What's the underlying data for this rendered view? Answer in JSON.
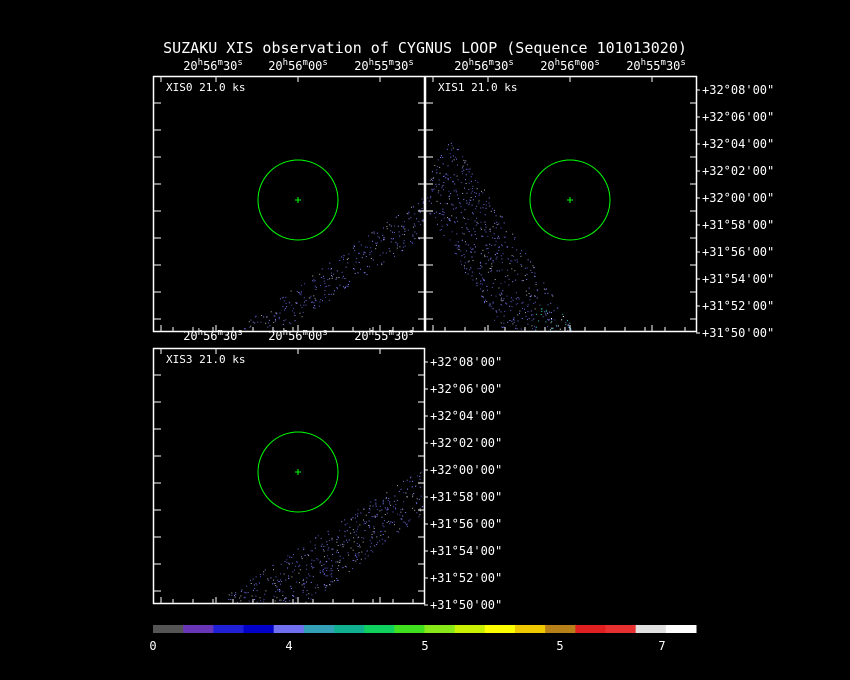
{
  "title": "SUZAKU XIS observation of CYGNUS LOOP  (Sequence 101013020)",
  "panels": [
    {
      "id": "xis0",
      "label": "XIS0 21.0 ks"
    },
    {
      "id": "xis1",
      "label": "XIS1 21.0 ks"
    },
    {
      "id": "xis3",
      "label": "XIS3 21.0 ks"
    }
  ],
  "ra_ticks": [
    {
      "h": "20",
      "m": "56",
      "s": "30"
    },
    {
      "h": "20",
      "m": "56",
      "s": "00"
    },
    {
      "h": "20",
      "m": "55",
      "s": "30"
    }
  ],
  "dec_ticks": [
    "+32°08'00\"",
    "+32°06'00\"",
    "+32°04'00\"",
    "+32°02'00\"",
    "+32°00'00\"",
    "+31°58'00\"",
    "+31°56'00\"",
    "+31°54'00\"",
    "+31°52'00\"",
    "+31°50'00\""
  ],
  "colorbar": {
    "colors": [
      "#555555",
      "#6a36b8",
      "#2020d8",
      "#0000c8",
      "#7070f0",
      "#33a0b8",
      "#10b090",
      "#10d060",
      "#40e020",
      "#88e818",
      "#c8f000",
      "#ffff00",
      "#f0c800",
      "#b88018",
      "#e02020",
      "#e83030",
      "#e0e0e0",
      "#ffffff"
    ],
    "labels": [
      "0",
      "4",
      "5",
      "5",
      "7"
    ]
  },
  "marker_color": "#00ff00",
  "frame_color": "#ffffff"
}
